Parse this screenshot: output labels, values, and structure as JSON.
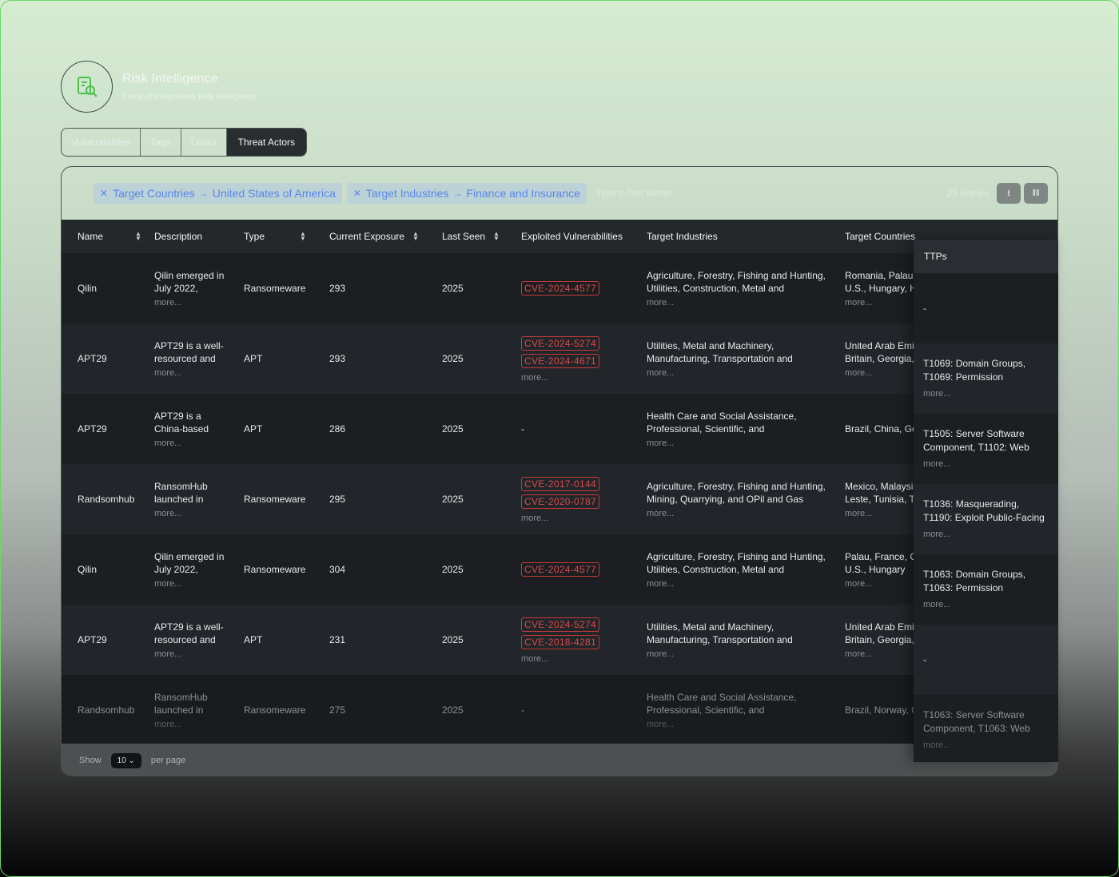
{
  "app": {
    "title": "Risk Intelligence",
    "subtitle": "Portal of Integrations Risk Intelligence"
  },
  "tabs": [
    {
      "label": "Vulnerabilities",
      "active": false
    },
    {
      "label": "Tags",
      "active": false
    },
    {
      "label": "Leaks",
      "active": false
    },
    {
      "label": "Threat Actors",
      "active": true
    }
  ],
  "filters": {
    "chips": [
      {
        "field": "Target Countries",
        "value": "United States of America"
      },
      {
        "field": "Target Industries",
        "value": "Finance and Insurance"
      }
    ],
    "placeholder": "Type to filter further",
    "entries_label": "23 entries"
  },
  "table": {
    "columns": [
      "Name",
      "Description",
      "Type",
      "Current Exposure",
      "Last Seen",
      "Exploited Vulnerabilities",
      "Target Industries",
      "Target Countries",
      "TTPs"
    ],
    "more_label": "more...",
    "rows": [
      {
        "name": "Qilin",
        "desc": [
          "Qilin emerged in",
          "July 2022,"
        ],
        "type": "Ransomeware",
        "exposure": "293",
        "last_seen": "2025",
        "cves": [
          "CVE-2024-4577"
        ],
        "cve_more": false,
        "industries": [
          "Agriculture, Forestry, Fishing and Hunting,",
          "Utilities, Construction, Metal and"
        ],
        "countries": [
          "Romania, Palau,",
          "U.S., Hungary, Ho"
        ],
        "countries_more": true,
        "ttps": "-",
        "ttps_more": false
      },
      {
        "name": "APT29",
        "desc": [
          "APT29 is a well-",
          "resourced and"
        ],
        "type": "APT",
        "exposure": "293",
        "last_seen": "2025",
        "cves": [
          "CVE-2024-5274",
          "CVE-2024-4671"
        ],
        "cve_more": true,
        "industries": [
          "Utilities, Metal and Machinery,",
          "Manufacturing, Transportation and"
        ],
        "countries": [
          "United Arab Emi",
          "Britain, Georgia,"
        ],
        "countries_more": true,
        "ttps": "T1069: Domain Groups, T1069: Permission",
        "ttps_more": true
      },
      {
        "name": "APT29",
        "desc": [
          "APT29 is a",
          "China-based"
        ],
        "type": "APT",
        "exposure": "286",
        "last_seen": "2025",
        "cves": [],
        "cve_more": false,
        "industries": [
          "Health Care and Social Assistance,",
          "Professional, Scientific, and"
        ],
        "countries": [
          "Brazil, China, Ge"
        ],
        "countries_more": false,
        "ttps": "T1505: Server Software Component, T1102: Web",
        "ttps_more": true
      },
      {
        "name": "Randsomhub",
        "desc": [
          "RansomHub",
          "launched in"
        ],
        "type": "Ransomeware",
        "exposure": "295",
        "last_seen": "2025",
        "cves": [
          "CVE-2017-0144",
          "CVE-2020-0787"
        ],
        "cve_more": true,
        "industries": [
          "Agriculture, Forestry, Fishing and Hunting,",
          "Mining, Quarrying, and OPil and Gas"
        ],
        "countries": [
          "Mexico, Malaysi",
          "Leste, Tunisia, T"
        ],
        "countries_more": true,
        "ttps": "T1036: Masquerading, T1190: Exploit Public-Facing",
        "ttps_more": true
      },
      {
        "name": "Qilin",
        "desc": [
          "Qilin emerged in",
          "July 2022,"
        ],
        "type": "Ransomeware",
        "exposure": "304",
        "last_seen": "2025",
        "cves": [
          "CVE-2024-4577"
        ],
        "cve_more": false,
        "industries": [
          "Agriculture, Forestry, Fishing and Hunting,",
          "Utilities, Construction, Metal and"
        ],
        "countries": [
          "Palau, France, Co",
          "U.S., Hungary"
        ],
        "countries_more": true,
        "ttps": "T1063: Domain Groups, T1063: Permission",
        "ttps_more": true
      },
      {
        "name": "APT29",
        "desc": [
          "APT29 is a well-",
          "resourced and"
        ],
        "type": "APT",
        "exposure": "231",
        "last_seen": "2025",
        "cves": [
          "CVE-2024-5274",
          "CVE-2018-4281"
        ],
        "cve_more": true,
        "industries": [
          "Utilities, Metal and Machinery,",
          "Manufacturing, Transportation and"
        ],
        "countries": [
          "United Arab Emi",
          "Britain, Georgia,"
        ],
        "countries_more": true,
        "ttps": "-",
        "ttps_more": false
      },
      {
        "name": "Randsomhub",
        "desc": [
          "RansomHub",
          "launched in"
        ],
        "type": "Ransomeware",
        "exposure": "275",
        "last_seen": "2025",
        "cves": [],
        "cve_more": false,
        "industries": [
          "Health Care and Social Assistance,",
          "Professional, Scientific, and"
        ],
        "countries": [
          "Brazil, Norway, G"
        ],
        "countries_more": false,
        "ttps": "T1063: Server Software Component, T1063: Web",
        "ttps_more": true
      }
    ]
  },
  "footer": {
    "rows_label": "Show",
    "page_size": "10",
    "suffix": "per page"
  },
  "colors": {
    "accent_green": "#4cc24c",
    "cve_red": "#d94a4a",
    "chip_blue": "#5a86e8"
  }
}
